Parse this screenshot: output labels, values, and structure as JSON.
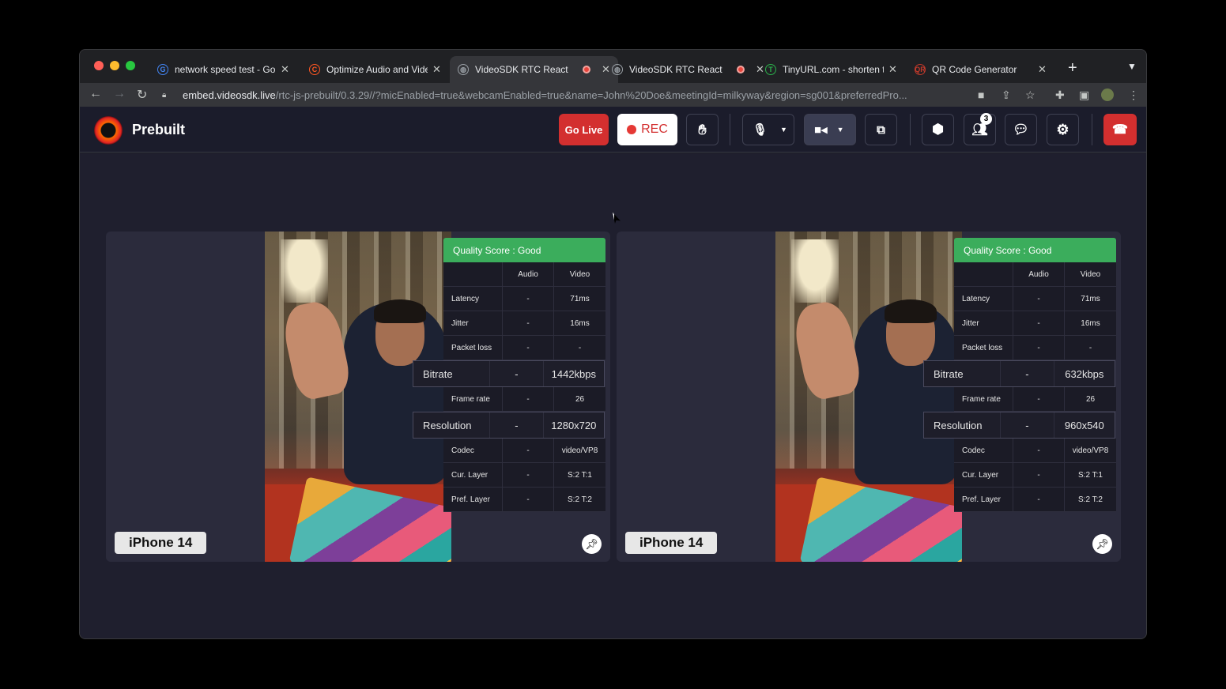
{
  "browser": {
    "tabs": [
      {
        "title": "network speed test - Go",
        "favicon": "G",
        "favicon_color": "#4285f4",
        "recording": false
      },
      {
        "title": "Optimize Audio and Vide",
        "favicon": "C",
        "favicon_color": "#ff5722",
        "recording": false
      },
      {
        "title": "VideoSDK RTC React",
        "favicon": "globe",
        "favicon_color": "#9aa0a6",
        "recording": true,
        "active": true
      },
      {
        "title": "VideoSDK RTC React",
        "favicon": "globe",
        "favicon_color": "#9aa0a6",
        "recording": true
      },
      {
        "title": "TinyURL.com - shorten t",
        "favicon": "T",
        "favicon_color": "#2bb24c",
        "recording": false
      },
      {
        "title": "QR Code Generator",
        "favicon": "QR",
        "favicon_color": "#c0392b",
        "recording": false
      }
    ],
    "close_glyph": "✕",
    "new_tab": "+",
    "url_host": "embed.videosdk.live",
    "url_path": "/rtc-js-prebuilt/0.3.29//?micEnabled=true&webcamEnabled=true&name=John%20Doe&meetingId=milkyway&region=sg001&preferredPro..."
  },
  "app": {
    "brand": "Prebuilt",
    "go_live_label": "Go Live",
    "rec_label": "REC",
    "participants_count": "3",
    "accent_red": "#d32f2f",
    "quality_green": "#3bad5c"
  },
  "participants": [
    {
      "name": "iPhone 14",
      "quality": "Quality Score : Good",
      "headers": [
        "",
        "Audio",
        "Video"
      ],
      "rows": [
        [
          "Latency",
          "-",
          "71ms"
        ],
        [
          "Jitter",
          "-",
          "16ms"
        ],
        [
          "Packet loss",
          "-",
          "-"
        ],
        [
          "Bitrate",
          "-",
          "1442kbps"
        ],
        [
          "Frame rate",
          "-",
          "26"
        ],
        [
          "Resolution",
          "-",
          "1280x720"
        ],
        [
          "Codec",
          "-",
          "video/VP8"
        ],
        [
          "Cur. Layer",
          "-",
          "S:2 T:1"
        ],
        [
          "Pref. Layer",
          "-",
          "S:2 T:2"
        ]
      ]
    },
    {
      "name": "iPhone 14",
      "quality": "Quality Score : Good",
      "headers": [
        "",
        "Audio",
        "Video"
      ],
      "rows": [
        [
          "Latency",
          "-",
          "71ms"
        ],
        [
          "Jitter",
          "-",
          "16ms"
        ],
        [
          "Packet loss",
          "-",
          "-"
        ],
        [
          "Bitrate",
          "-",
          "632kbps"
        ],
        [
          "Frame rate",
          "-",
          "26"
        ],
        [
          "Resolution",
          "-",
          "960x540"
        ],
        [
          "Codec",
          "-",
          "video/VP8"
        ],
        [
          "Cur. Layer",
          "-",
          "S:2 T:1"
        ],
        [
          "Pref. Layer",
          "-",
          "S:2 T:2"
        ]
      ]
    }
  ]
}
